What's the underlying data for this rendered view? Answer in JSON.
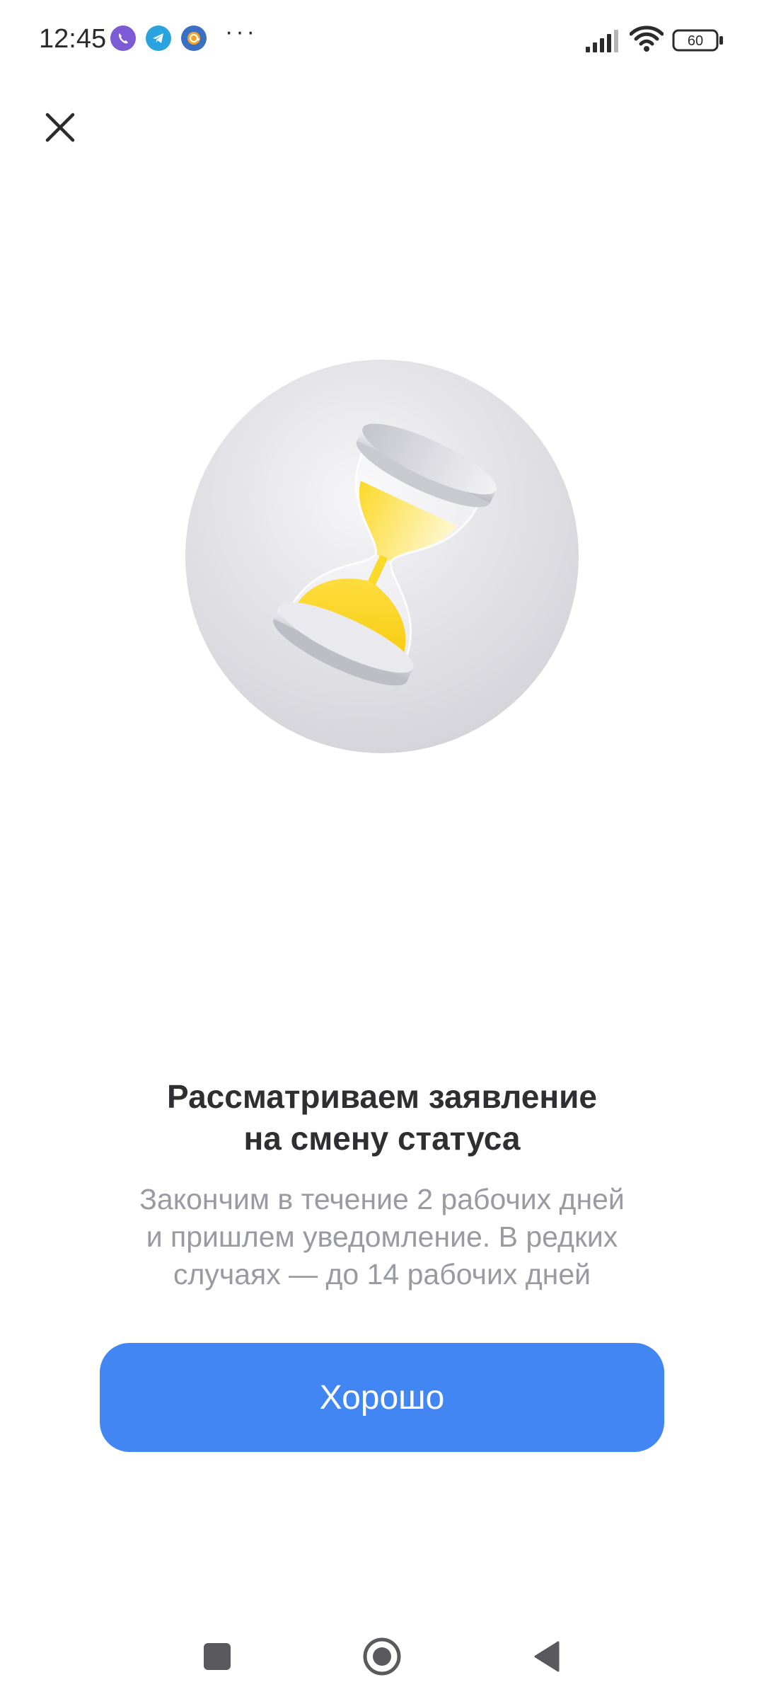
{
  "status_bar": {
    "time": "12:45",
    "notification_icons": [
      "viber-icon",
      "telegram-icon",
      "email-at-icon"
    ],
    "more_indicator": "···",
    "battery_level": "60"
  },
  "dialog": {
    "close_icon": "close-icon",
    "illustration": "hourglass-illustration",
    "title": "Рассматриваем заявление\nна смену статуса",
    "description": "Закончим в течение 2 рабочих дней\nи пришлем уведомление. В редких\nслучаях — до 14 рабочих дней",
    "ok_button_label": "Хорошо"
  },
  "colors": {
    "accent": "#4286f4",
    "title_text": "#2f2f33",
    "secondary_text": "#9a9aa2",
    "sand": "#f9d92a"
  },
  "nav_bar": {
    "icons": [
      "recents-square-icon",
      "home-circle-icon",
      "back-triangle-icon"
    ]
  }
}
